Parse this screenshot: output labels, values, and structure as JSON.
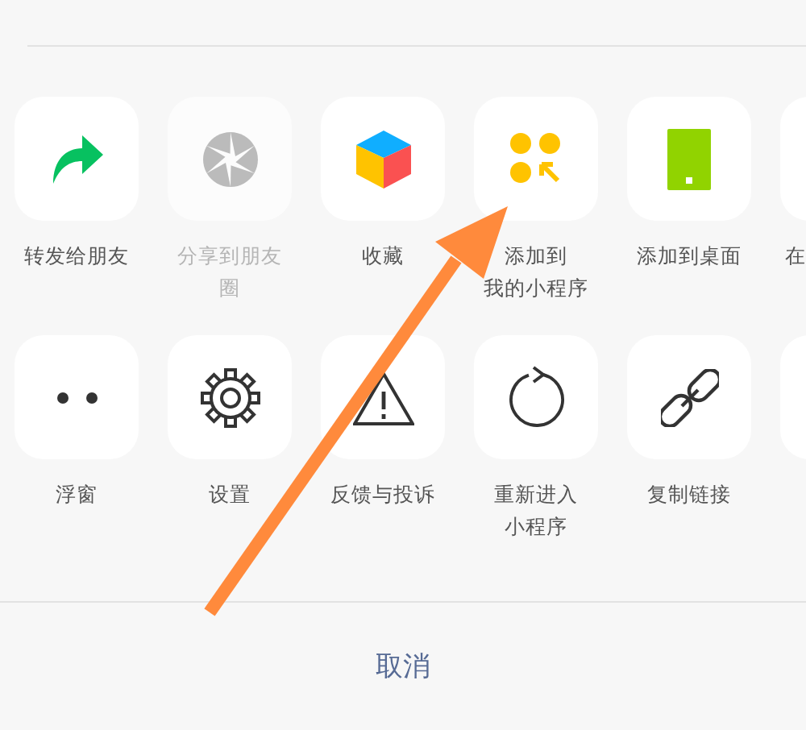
{
  "rows": [
    [
      {
        "kind": "forward",
        "lines": [
          "转发给朋友"
        ],
        "disabled": false
      },
      {
        "kind": "moments",
        "lines": [
          "分享到朋友圈"
        ],
        "disabled": true
      },
      {
        "kind": "favorite",
        "lines": [
          "收藏"
        ],
        "disabled": false
      },
      {
        "kind": "mini",
        "lines": [
          "添加到",
          "我的小程序"
        ],
        "disabled": false
      },
      {
        "kind": "desktop",
        "lines": [
          "添加到桌面"
        ],
        "disabled": false
      },
      {
        "kind": "blank",
        "lines": [
          "在"
        ]
      }
    ],
    [
      {
        "kind": "float",
        "lines": [
          "浮窗"
        ],
        "disabled": false
      },
      {
        "kind": "settings",
        "lines": [
          "设置"
        ],
        "disabled": false
      },
      {
        "kind": "warning",
        "lines": [
          "反馈与投诉"
        ],
        "disabled": false
      },
      {
        "kind": "reload",
        "lines": [
          "重新进入",
          "小程序"
        ],
        "disabled": false
      },
      {
        "kind": "link",
        "lines": [
          "复制链接"
        ],
        "disabled": false
      },
      {
        "kind": "blank"
      }
    ]
  ],
  "cancel": "取消"
}
